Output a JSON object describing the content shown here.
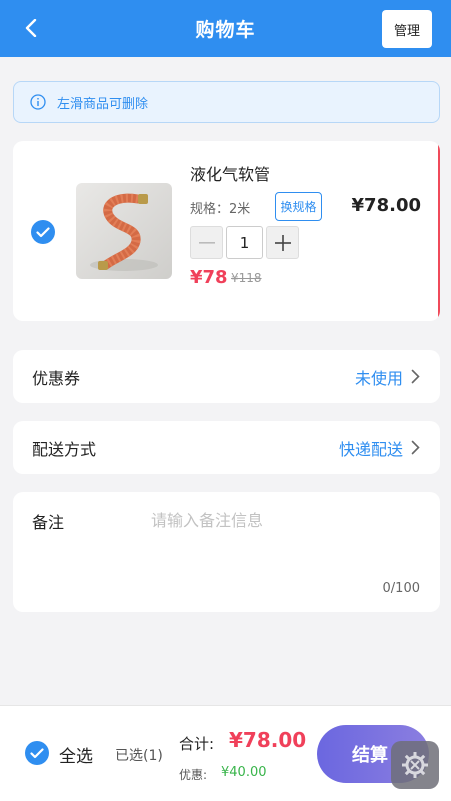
{
  "header": {
    "title": "购物车",
    "manage_label": "管理"
  },
  "tip": {
    "text": "左滑商品可删除"
  },
  "cart_item": {
    "name": "液化气软管",
    "spec": "规格：2米",
    "change_spec_label": "换规格",
    "unit_price": "¥78.00",
    "quantity": "1",
    "sale_price": "¥78",
    "original_price": "¥118",
    "checked": true
  },
  "coupon": {
    "label": "优惠券",
    "value": "未使用"
  },
  "delivery": {
    "label": "配送方式",
    "value": "快递配送"
  },
  "remark": {
    "label": "备注",
    "placeholder": "请输入备注信息",
    "count": "0/100"
  },
  "footer": {
    "select_all_label": "全选",
    "selected_text": "已选(1)",
    "total_label": "合计:",
    "total_value": "¥78.00",
    "discount_label": "优惠:",
    "discount_value": "¥40.00",
    "checkout_label": "结算"
  },
  "colors": {
    "primary": "#2f8ef0",
    "price_red": "#f0405a",
    "discount_green": "#38b44a",
    "checkout_gradient_start": "#6b67e0",
    "checkout_gradient_end": "#8b7ee0"
  },
  "icons": [
    "back-icon",
    "info-icon",
    "check-icon",
    "minus-icon",
    "plus-icon",
    "chevron-right-icon",
    "gear-icon"
  ]
}
